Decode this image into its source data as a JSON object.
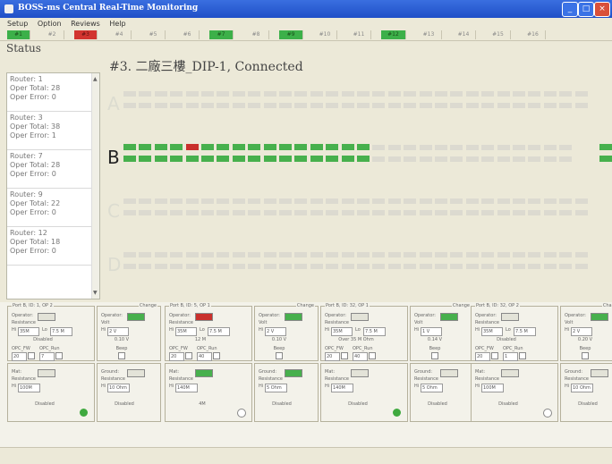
{
  "window": {
    "title": "BOSS-ms Central Real-Time Monitoring"
  },
  "menu": [
    "Setup",
    "Option",
    "Reviews",
    "Help"
  ],
  "tabs": [
    {
      "label": "#1",
      "state": "green"
    },
    {
      "label": "#2",
      "state": "gray"
    },
    {
      "label": "#3",
      "state": "red"
    },
    {
      "label": "#4",
      "state": "gray"
    },
    {
      "label": "#5",
      "state": "gray"
    },
    {
      "label": "#6",
      "state": "gray"
    },
    {
      "label": "#7",
      "state": "green"
    },
    {
      "label": "#8",
      "state": "gray"
    },
    {
      "label": "#9",
      "state": "green"
    },
    {
      "label": "#10",
      "state": "gray"
    },
    {
      "label": "#11",
      "state": "gray"
    },
    {
      "label": "#12",
      "state": "green"
    },
    {
      "label": "#13",
      "state": "gray"
    },
    {
      "label": "#14",
      "state": "gray"
    },
    {
      "label": "#15",
      "state": "gray"
    },
    {
      "label": "#16",
      "state": "gray"
    }
  ],
  "status": {
    "header": "Status",
    "routers": [
      {
        "router": "Router: 1",
        "total": "Oper Total: 28",
        "error": "Oper Error: 0"
      },
      {
        "router": "Router: 3",
        "total": "Oper Total: 38",
        "error": "Oper Error: 1"
      },
      {
        "router": "Router: 7",
        "total": "Oper Total: 28",
        "error": "Oper Error: 0"
      },
      {
        "router": "Router: 9",
        "total": "Oper Total: 22",
        "error": "Oper Error: 0"
      },
      {
        "router": "Router: 12",
        "total": "Oper Total: 18",
        "error": "Oper Error: 0"
      }
    ]
  },
  "main": {
    "header": "#3. 二廠三樓_DIP-1, Connected"
  },
  "banks": [
    {
      "letter": "A",
      "active": false,
      "rows": [
        {
          "on": 0,
          "err": -1,
          "tail": false
        },
        {
          "on": 0,
          "err": -1,
          "tail": false
        }
      ]
    },
    {
      "letter": "B",
      "active": true,
      "rows": [
        {
          "on": 16,
          "err": 4,
          "tail": true
        },
        {
          "on": 16,
          "err": -1,
          "tail": true
        }
      ]
    },
    {
      "letter": "C",
      "active": false,
      "rows": [
        {
          "on": 0,
          "err": -1,
          "tail": false
        },
        {
          "on": 0,
          "err": -1,
          "tail": false
        }
      ]
    },
    {
      "letter": "D",
      "active": false,
      "rows": [
        {
          "on": 0,
          "err": -1,
          "tail": false
        },
        {
          "on": 0,
          "err": -1,
          "tail": false
        }
      ]
    }
  ],
  "panels": [
    {
      "legend": "Port B, ID: 1, OP 2",
      "change": "Change",
      "operator": {
        "label": "Operator:",
        "state": "gray",
        "res_label": "Resistance",
        "hi_label": "Hi",
        "hi": "35M",
        "lo_label": "Lo",
        "lo": "7.5 M",
        "status": "Disabled"
      },
      "volt": {
        "label": "Operator:",
        "state": "green",
        "unit": "Volt",
        "hi_label": "Hi",
        "hi": "2 V",
        "value": "0.10 V"
      },
      "opc": {
        "fw": "OPC_FW",
        "run": "OPC_Run",
        "v1": "20",
        "v2": "7",
        "beep": "Beep"
      },
      "mat": {
        "label": "Mat:",
        "state": "gray",
        "res_label": "Resistance",
        "hi_label": "Hi",
        "hi": "100M",
        "status": "Disabled",
        "dot": "green"
      },
      "ground": {
        "label": "Ground:",
        "state": "gray",
        "res_label": "Resistance",
        "hi_label": "Hi",
        "hi": "10 Ohm",
        "status": "Disabled"
      }
    },
    {
      "legend": "Port B, ID: 5, OP 1",
      "change": "Change",
      "operator": {
        "label": "Operator:",
        "state": "red",
        "res_label": "Resistance",
        "hi_label": "Hi",
        "hi": "35M",
        "lo_label": "Lo",
        "lo": "7.5 M",
        "status": "12 M"
      },
      "volt": {
        "label": "Operator:",
        "state": "green",
        "unit": "Volt",
        "hi_label": "Hi",
        "hi": "2 V",
        "value": "0.10 V"
      },
      "opc": {
        "fw": "OPC_FW",
        "run": "OPC_Run",
        "v1": "20",
        "v2": "40",
        "beep": "Beep"
      },
      "mat": {
        "label": "Mat:",
        "state": "green",
        "res_label": "Resistance",
        "hi_label": "Hi",
        "hi": "140M",
        "status": "4M",
        "dot": "empty"
      },
      "ground": {
        "label": "Ground:",
        "state": "green",
        "res_label": "Resistance",
        "hi_label": "Hi",
        "hi": "5 Ohm",
        "status": "Disabled"
      }
    },
    {
      "legend": "Port B, ID: 32, OP 1",
      "change": "Change",
      "operator": {
        "label": "Operator:",
        "state": "gray",
        "res_label": "Resistance",
        "hi_label": "Hi",
        "hi": "35M",
        "lo_label": "Lo",
        "lo": "7.5 M",
        "status": "Over 35 M Ohm"
      },
      "volt": {
        "label": "Operator:",
        "state": "green",
        "unit": "Volt",
        "hi_label": "Hi",
        "hi": "1 V",
        "value": "0.14 V"
      },
      "opc": {
        "fw": "OPC_FW",
        "run": "OPC_Run",
        "v1": "20",
        "v2": "40",
        "beep": "Beep"
      },
      "mat": {
        "label": "Mat:",
        "state": "gray",
        "res_label": "Resistance",
        "hi_label": "Hi",
        "hi": "140M",
        "status": "Disabled",
        "dot": "green"
      },
      "ground": {
        "label": "Ground:",
        "state": "gray",
        "res_label": "Resistance",
        "hi_label": "Hi",
        "hi": "5 Ohm",
        "status": "Disabled"
      }
    },
    {
      "legend": "Port B, ID: 32, OP 2",
      "change": "Change",
      "operator": {
        "label": "Operator:",
        "state": "gray",
        "res_label": "Resistance",
        "hi_label": "Hi",
        "hi": "35M",
        "lo_label": "Lo",
        "lo": "7.5 M",
        "status": "Disabled"
      },
      "volt": {
        "label": "Operator:",
        "state": "green",
        "unit": "Volt",
        "hi_label": "Hi",
        "hi": "2 V",
        "value": "0.20 V"
      },
      "opc": {
        "fw": "OPC_FW",
        "run": "OPC_Run",
        "v1": "20",
        "v2": "1",
        "beep": "Beep"
      },
      "mat": {
        "label": "Mat:",
        "state": "gray",
        "res_label": "Resistance",
        "hi_label": "Hi",
        "hi": "100M",
        "status": "Disabled",
        "dot": "empty"
      },
      "ground": {
        "label": "Ground:",
        "state": "gray",
        "res_label": "Resistance",
        "hi_label": "Hi",
        "hi": "10 Ohm",
        "status": "Disabled"
      }
    }
  ]
}
